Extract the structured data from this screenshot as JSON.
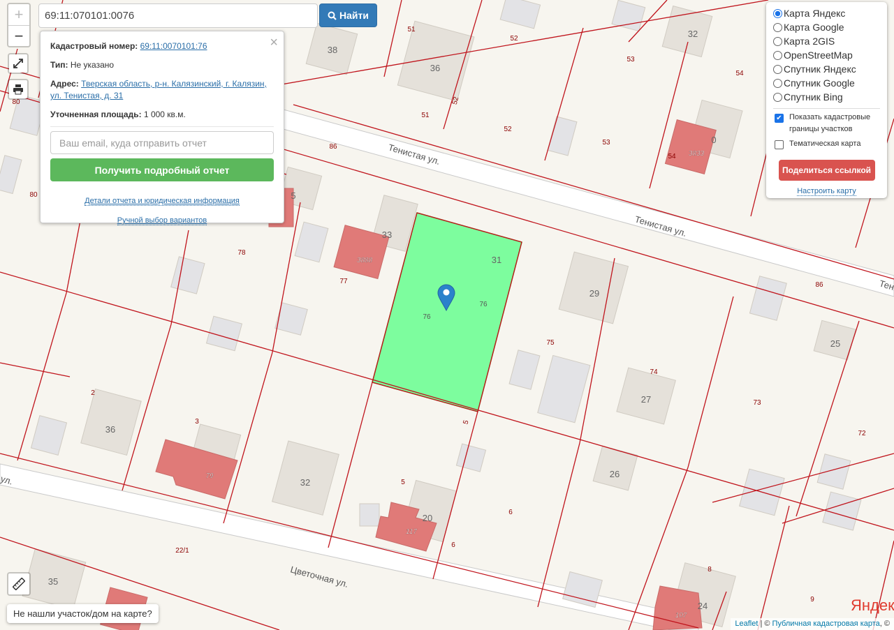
{
  "search": {
    "value": "69:11:070101:0076",
    "button": "Найти"
  },
  "zoom": {
    "in": "+",
    "out": "−"
  },
  "popup": {
    "cadastral_label": "Кадастровый номер:",
    "cadastral_value": "69:11:0070101:76",
    "type_label": "Тип:",
    "type_value": "Не указано",
    "address_label": "Адрес:",
    "address_value": "Тверская область, р-н. Калязинский, г. Калязин, ул. Тенистая, д. 31",
    "area_label": "Уточненная площадь:",
    "area_value": "1 000 кв.м.",
    "email_placeholder": "Ваш email, куда отправить отчет",
    "get_report": "Получить подробный отчет",
    "details_link": "Детали отчета и юридическая информация",
    "manual_link": "Ручной выбор вариантов",
    "close": "×"
  },
  "layers": {
    "options": [
      "Карта Яндекс",
      "Карта Google",
      "Карта 2GIS",
      "OpenStreetMap",
      "Спутник Яндекс",
      "Спутник Google",
      "Спутник Bing"
    ],
    "selected": "Карта Яндекс",
    "show_borders": "Показать кадастровые границы участков",
    "show_borders_checked": true,
    "thematic": "Тематическая карта",
    "thematic_checked": false,
    "share": "Поделиться ссылкой",
    "configure": "Настроить карту"
  },
  "not_found": "Не нашли участок/дом на карте?",
  "attribution": {
    "leaflet": "Leaflet",
    "sep": " | © ",
    "pkk": "Публичная кадастровая карта",
    "tail": ", ©"
  },
  "map_logo": "Яндекс",
  "map_labels": {
    "streets": [
      "Тенистая ул.",
      "Тенистая ул.",
      "Цветочная ул.",
      "Тени",
      "ул."
    ],
    "buildings": [
      "38",
      "36",
      "32",
      "31",
      "29",
      "27",
      "26",
      "25",
      "36",
      "32",
      "35",
      "24",
      "33",
      "3888",
      "3833",
      "79",
      "117",
      "107",
      "20",
      "0",
      "5"
    ],
    "parcels": [
      "51",
      "52",
      "52",
      "51",
      "52",
      "53",
      "53",
      "54",
      "54",
      "86",
      "86",
      "80",
      "80",
      "78",
      "77",
      "76",
      "76",
      "75",
      "74",
      "73",
      "72",
      "2",
      "3",
      "5",
      "5",
      "6",
      "6",
      "22/1",
      "8",
      "9"
    ]
  },
  "colors": {
    "parcel_line": "#c0141c",
    "selected_parcel": "#7dfd9e",
    "building": "#e5e1da",
    "building_red": "#e07a78",
    "accent": "#337ab7",
    "green_btn": "#5cb85c",
    "red_btn": "#d9534f"
  }
}
